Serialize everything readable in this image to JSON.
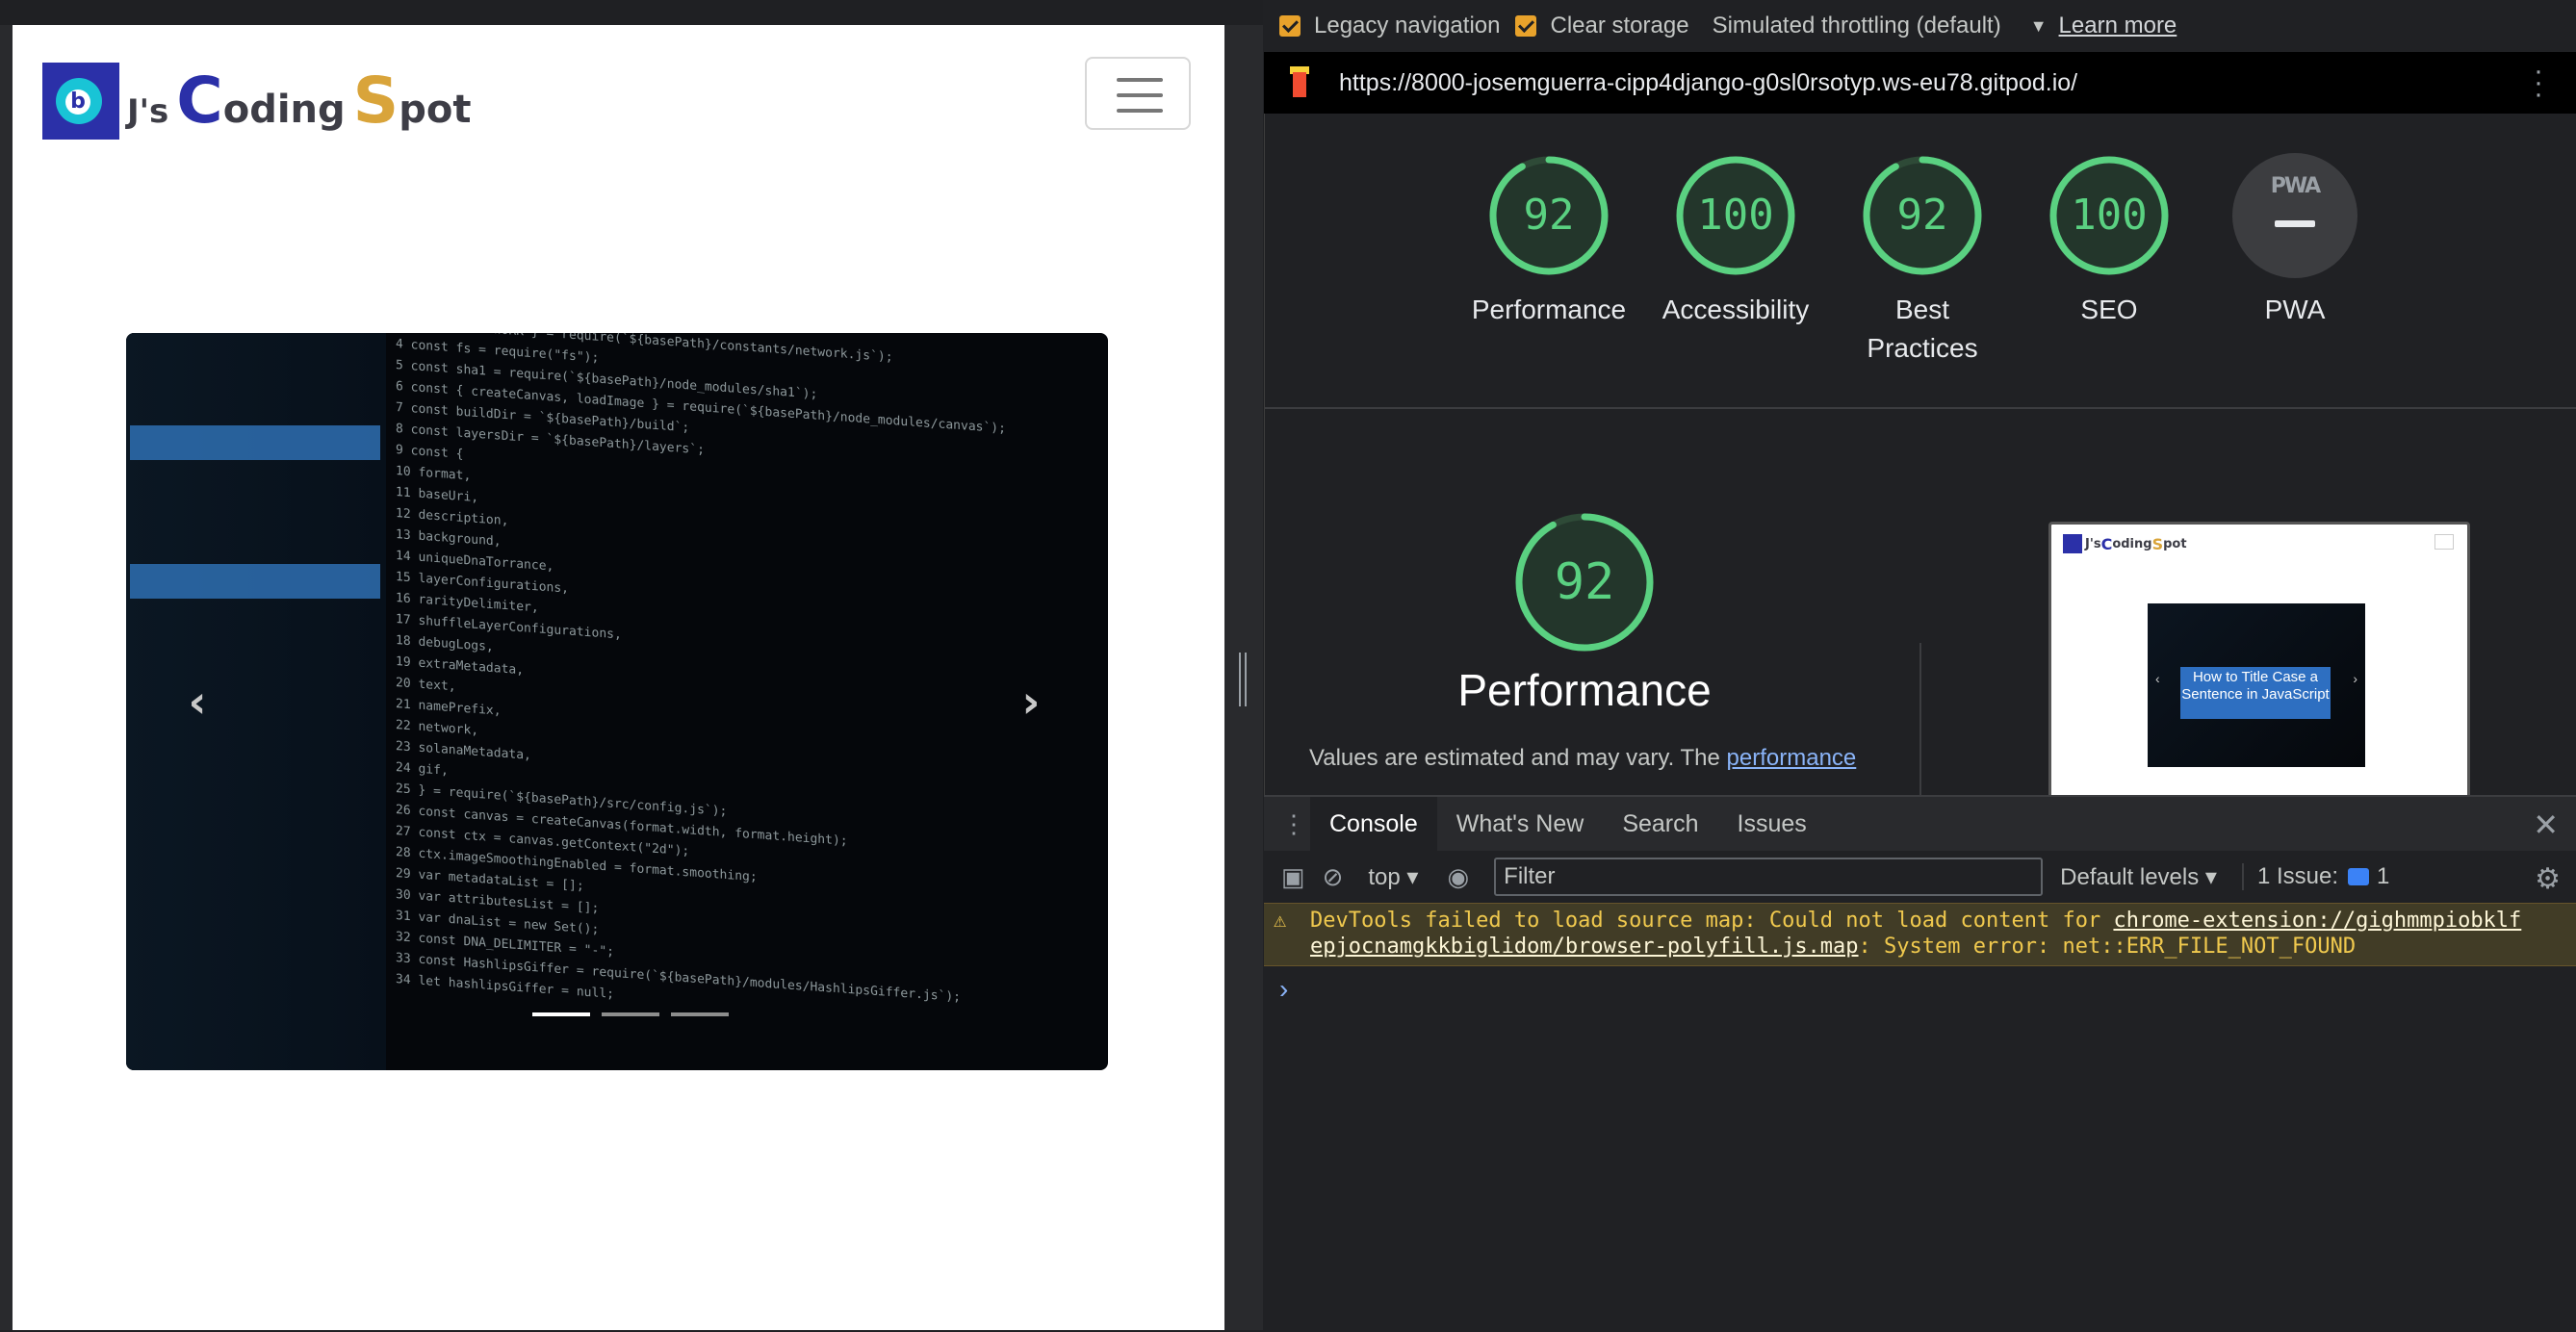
{
  "site": {
    "logo_text_prefix": "J's",
    "logo_c": "C",
    "logo_oding": "oding",
    "logo_s": "S",
    "logo_pot": "pot",
    "carousel_prev": "‹",
    "carousel_next": "›",
    "carousel_indicators": 3,
    "carousel_active_index": 0
  },
  "lighthouse": {
    "options": {
      "legacy_navigation": "Legacy navigation",
      "clear_storage": "Clear storage",
      "throttling": "Simulated throttling (default)",
      "learn_more": "Learn more"
    },
    "url": "https://8000-josemguerra-cipp4django-g0sl0rsotyp.ws-eu78.gitpod.io/",
    "scores": [
      {
        "label": "Performance",
        "value": "92"
      },
      {
        "label": "Accessibility",
        "value": "100"
      },
      {
        "label": "Best Practices",
        "value": "92"
      },
      {
        "label": "SEO",
        "value": "100"
      }
    ],
    "pwa": {
      "label": "PWA",
      "badge": "PWA"
    },
    "performance_section": {
      "score": "92",
      "title": "Performance",
      "desc_prefix": "Values are estimated and may vary. The ",
      "desc_link": "performance"
    },
    "thumbnail": {
      "logo_prefix": "J's",
      "logo_c": "C",
      "logo_oding": "oding",
      "logo_s": "S",
      "logo_pot": "pot",
      "caption": "How to Title Case a Sentence in JavaScript"
    },
    "colors": {
      "pass": "#5ad181",
      "pwa_bg": "#3c3d40"
    }
  },
  "console_drawer": {
    "tabs": [
      "Console",
      "What's New",
      "Search",
      "Issues"
    ],
    "active_tab": "Console",
    "context": "top",
    "filter_placeholder": "Filter",
    "levels": "Default levels",
    "issues": "1 Issue:",
    "issues_count": "1",
    "warning": {
      "line1_prefix": "DevTools failed to load source map: Could not load content for ",
      "line1_link": "chrome-extension://gighmmpiobklf",
      "line2_link": "epjocnamgkkbiglidom/browser-polyfill.js.map",
      "line2_suffix": ": System error: net::ERR_FILE_NOT_FOUND"
    },
    "prompt": "›"
  }
}
